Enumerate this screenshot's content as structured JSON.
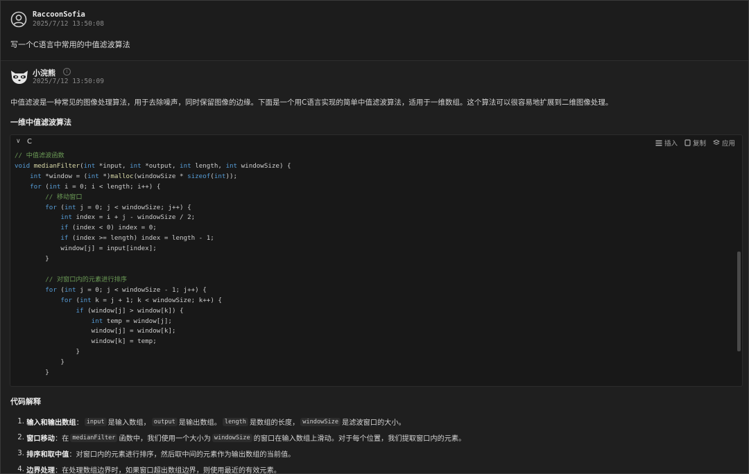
{
  "user_message": {
    "username": "RaccoonSofia",
    "timestamp": "2025/7/12 13:50:08",
    "text": "写一个C语言中常用的中值滤波算法"
  },
  "assistant_message": {
    "name": "小浣熊",
    "timestamp": "2025/7/12 13:50:09",
    "info_icon": "info-icon",
    "intro": "中值滤波是一种常见的图像处理算法，用于去除噪声，同时保留图像的边缘。下面是一个用C语言实现的简单中值滤波算法，适用于一维数组。这个算法可以很容易地扩展到二维图像处理。",
    "section_title": "一维中值滤波算法",
    "code_block": {
      "language": "C",
      "insert_label": "插入",
      "copy_label": "复制",
      "apply_label": "应用",
      "lines": [
        "// 中值滤波函数",
        "void medianFilter(int *input, int *output, int length, int windowSize) {",
        "    int *window = (int *)malloc(windowSize * sizeof(int));",
        "    for (int i = 0; i < length; i++) {",
        "        // 移动窗口",
        "        for (int j = 0; j < windowSize; j++) {",
        "            int index = i + j - windowSize / 2;",
        "            if (index < 0) index = 0;",
        "            if (index >= length) index = length - 1;",
        "            window[j] = input[index];",
        "        }",
        "",
        "        // 对窗口内的元素进行排序",
        "        for (int j = 0; j < windowSize - 1; j++) {",
        "            for (int k = j + 1; k < windowSize; k++) {",
        "                if (window[j] > window[k]) {",
        "                    int temp = window[j];",
        "                    window[j] = window[k];",
        "                    window[k] = temp;",
        "                }",
        "            }",
        "        }"
      ]
    },
    "explanation_title": "代码解释",
    "explanation_items": [
      {
        "number": "1.",
        "parts": [
          {
            "bold": "输入和输出数组"
          },
          {
            "text": "："
          },
          {
            "code": "input"
          },
          {
            "text": "是输入数组，"
          },
          {
            "code": "output"
          },
          {
            "text": "是输出数组。"
          },
          {
            "code": "length"
          },
          {
            "text": "是数组的长度，"
          },
          {
            "code": "windowSize"
          },
          {
            "text": "是滤波窗口的大小。"
          }
        ]
      },
      {
        "number": "2.",
        "parts": [
          {
            "bold": "窗口移动"
          },
          {
            "text": "：在"
          },
          {
            "code": "medianFilter"
          },
          {
            "text": "函数中，我们使用一个大小为"
          },
          {
            "code": "windowSize"
          },
          {
            "text": "的窗口在输入数组上滑动。对于每个位置，我们提取窗口内的元素。"
          }
        ]
      },
      {
        "number": "3.",
        "parts": [
          {
            "bold": "排序和取中值"
          },
          {
            "text": "：对窗口内的元素进行排序，然后取中间的元素作为输出数组的当前值。"
          }
        ]
      },
      {
        "number": "4.",
        "parts": [
          {
            "bold": "边界处理"
          },
          {
            "text": "：在处理数组边界时，如果窗口超出数组边界，则使用最近的有效元素。"
          }
        ]
      }
    ]
  }
}
